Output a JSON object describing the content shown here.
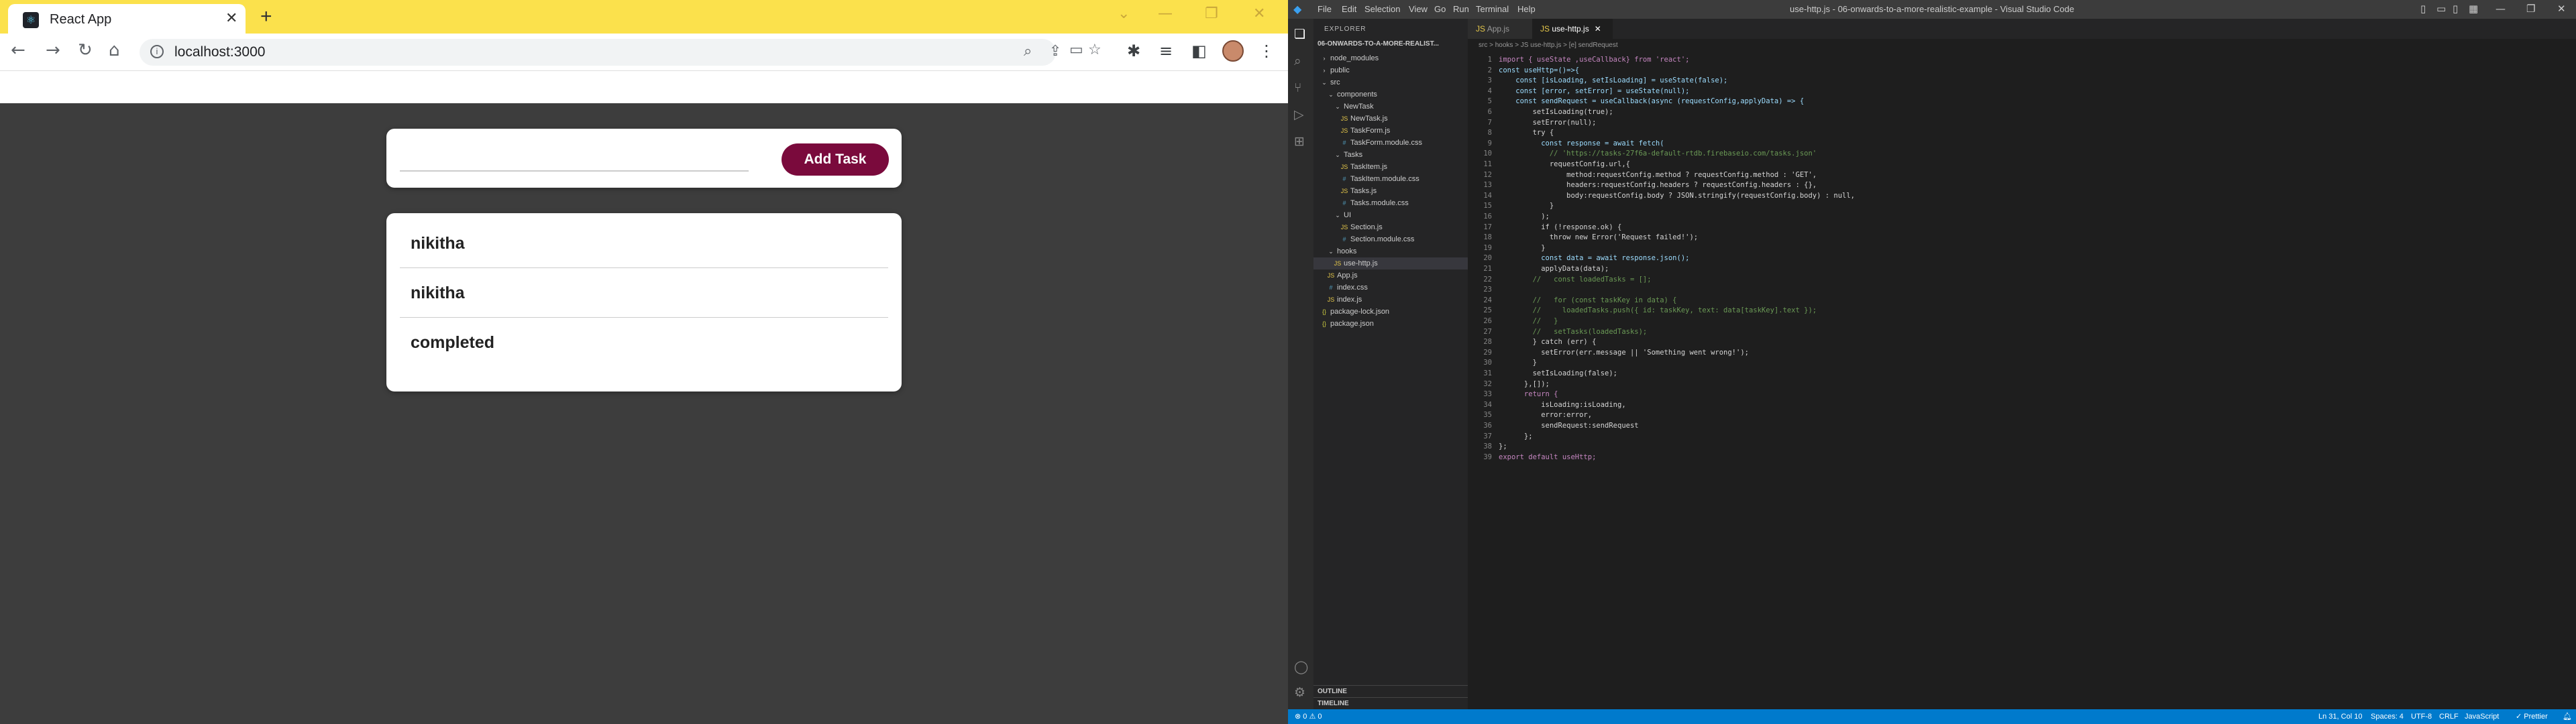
{
  "chrome": {
    "tab_title": "React App",
    "tab_close": "✕",
    "new_tab": "+",
    "url": "localhost:3000",
    "app": {
      "input_value": "",
      "add_button": "Add Task",
      "tasks": [
        "nikitha",
        "nikitha",
        "completed"
      ]
    }
  },
  "vscode": {
    "menu": [
      "File",
      "Edit",
      "Selection",
      "View",
      "Go",
      "Run",
      "Terminal",
      "Help"
    ],
    "window_title": "use-http.js - 06-onwards-to-a-more-realistic-example - Visual Studio Code",
    "explorer_header": "EXPLORER",
    "root_folder": "06-ONWARDS-TO-A-MORE-REALIST...",
    "tree": [
      {
        "label": "node_modules",
        "depth": 1,
        "kind": "folder-closed"
      },
      {
        "label": "public",
        "depth": 1,
        "kind": "folder-closed"
      },
      {
        "label": "src",
        "depth": 1,
        "kind": "folder-open"
      },
      {
        "label": "components",
        "depth": 2,
        "kind": "folder-open"
      },
      {
        "label": "NewTask",
        "depth": 3,
        "kind": "folder-open"
      },
      {
        "label": "NewTask.js",
        "depth": 4,
        "kind": "js"
      },
      {
        "label": "TaskForm.js",
        "depth": 4,
        "kind": "js"
      },
      {
        "label": "TaskForm.module.css",
        "depth": 4,
        "kind": "css"
      },
      {
        "label": "Tasks",
        "depth": 3,
        "kind": "folder-open"
      },
      {
        "label": "TaskItem.js",
        "depth": 4,
        "kind": "js"
      },
      {
        "label": "TaskItem.module.css",
        "depth": 4,
        "kind": "css"
      },
      {
        "label": "Tasks.js",
        "depth": 4,
        "kind": "js"
      },
      {
        "label": "Tasks.module.css",
        "depth": 4,
        "kind": "css"
      },
      {
        "label": "UI",
        "depth": 3,
        "kind": "folder-open"
      },
      {
        "label": "Section.js",
        "depth": 4,
        "kind": "js"
      },
      {
        "label": "Section.module.css",
        "depth": 4,
        "kind": "css"
      },
      {
        "label": "hooks",
        "depth": 2,
        "kind": "folder-open"
      },
      {
        "label": "use-http.js",
        "depth": 3,
        "kind": "js",
        "selected": true
      },
      {
        "label": "App.js",
        "depth": 2,
        "kind": "js"
      },
      {
        "label": "index.css",
        "depth": 2,
        "kind": "css"
      },
      {
        "label": "index.js",
        "depth": 2,
        "kind": "js"
      },
      {
        "label": "package-lock.json",
        "depth": 1,
        "kind": "json"
      },
      {
        "label": "package.json",
        "depth": 1,
        "kind": "json"
      }
    ],
    "outline": "OUTLINE",
    "timeline": "TIMELINE",
    "tabs": [
      {
        "label": "App.js",
        "active": false
      },
      {
        "label": "use-http.js",
        "active": true
      }
    ],
    "breadcrumb": "src > hooks > JS use-http.js > [e] sendRequest",
    "code": [
      "import { useState ,useCallback} from 'react';",
      "const useHttp=()=>{",
      "    const [isLoading, setIsLoading] = useState(false);",
      "    const [error, setError] = useState(null);",
      "    const sendRequest = useCallback(async (requestConfig,applyData) => {",
      "        setIsLoading(true);",
      "        setError(null);",
      "        try {",
      "          const response = await fetch(",
      "            // 'https://tasks-27f6a-default-rtdb.firebaseio.com/tasks.json'",
      "            requestConfig.url,{",
      "                method:requestConfig.method ? requestConfig.method : 'GET',",
      "                headers:requestConfig.headers ? requestConfig.headers : {},",
      "                body:requestConfig.body ? JSON.stringify(requestConfig.body) : null,",
      "            }",
      "          );",
      "          if (!response.ok) {",
      "            throw new Error('Request failed!');",
      "          }",
      "          const data = await response.json();",
      "          applyData(data);",
      "        //   const loadedTasks = [];",
      "",
      "        //   for (const taskKey in data) {",
      "        //     loadedTasks.push({ id: taskKey, text: data[taskKey].text });",
      "        //   }",
      "        //   setTasks(loadedTasks);",
      "        } catch (err) {",
      "          setError(err.message || 'Something went wrong!');",
      "        }",
      "        setIsLoading(false);",
      "      },[]);",
      "      return {",
      "          isLoading:isLoading,",
      "          error:error,",
      "          sendRequest:sendRequest",
      "      };",
      "};",
      "export default useHttp;"
    ],
    "status": {
      "left": "⊗ 0  ⚠ 0",
      "position": "Ln 31, Col 10",
      "spaces": "Spaces: 4",
      "encoding": "UTF-8",
      "eol": "CRLF",
      "language": "JavaScript",
      "prettier": "✓ Prettier"
    }
  }
}
